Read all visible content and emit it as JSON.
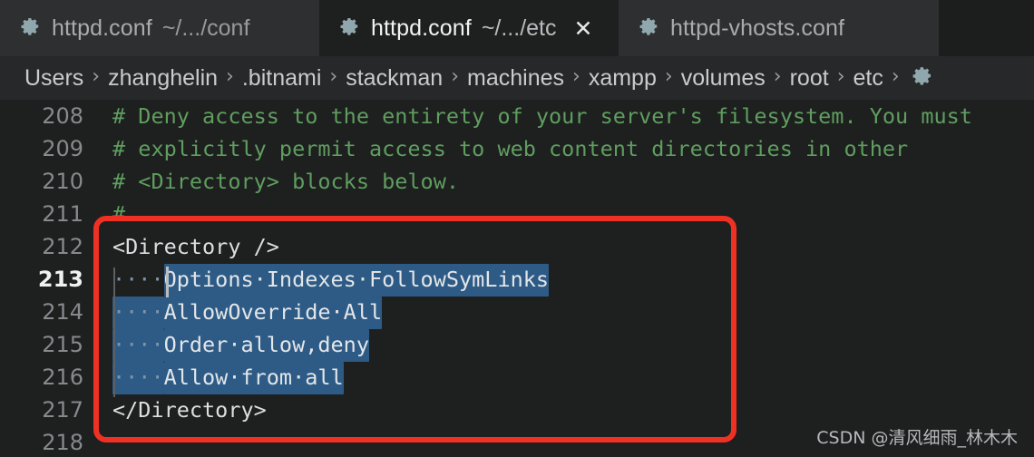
{
  "colors": {
    "tabbar_bg": "#1c1d1d",
    "tab_inactive_bg": "#2d2f30",
    "tab_active_bg": "#1e1f1f",
    "breadcrumb_bg": "#262829",
    "editor_bg": "#1e1f1f",
    "selection": "#2d5b86",
    "comment_green": "#5f9e5f",
    "annotation_red": "#ef3124",
    "gear_icon": "#90a7ad",
    "line_number": "#868a8c",
    "code_text": "#d4d6d7"
  },
  "tabs": [
    {
      "icon": "gear-icon",
      "title": "httpd.conf",
      "path": "~/.../conf",
      "active": false,
      "closable": false
    },
    {
      "icon": "gear-icon",
      "title": "httpd.conf",
      "path": "~/.../etc",
      "active": true,
      "closable": true,
      "close_label": "✕"
    },
    {
      "icon": "gear-icon",
      "title": "httpd-vhosts.conf",
      "path": "",
      "active": false,
      "closable": false
    }
  ],
  "breadcrumb": {
    "separator": "›",
    "items": [
      "Users",
      "zhanghelin",
      ".bitnami",
      "stackman",
      "machines",
      "xampp",
      "volumes",
      "root",
      "etc"
    ],
    "trailing_icon": "gear-icon"
  },
  "editor": {
    "active_line": 213,
    "lines": [
      {
        "number": "208",
        "kind": "comment",
        "text": "# Deny access to the entirety of your server's filesystem. You must"
      },
      {
        "number": "209",
        "kind": "comment",
        "text": "# explicitly permit access to web content directories in other"
      },
      {
        "number": "210",
        "kind": "comment",
        "text": "# <Directory> blocks below."
      },
      {
        "number": "211",
        "kind": "comment",
        "text": "#"
      },
      {
        "number": "212",
        "kind": "plain",
        "text": "<Directory />"
      },
      {
        "number": "213",
        "kind": "selected",
        "indent_ws": "····",
        "text": "Options·Indexes·FollowSymLinks",
        "indent_selected": false
      },
      {
        "number": "214",
        "kind": "selected",
        "indent_ws": "····",
        "text": "AllowOverride·All",
        "indent_selected": true
      },
      {
        "number": "215",
        "kind": "selected",
        "indent_ws": "····",
        "text": "Order·allow,deny",
        "indent_selected": true
      },
      {
        "number": "216",
        "kind": "selected",
        "indent_ws": "····",
        "text": "Allow·from·all",
        "indent_selected": true
      },
      {
        "number": "217",
        "kind": "plain",
        "text": "</Directory>"
      },
      {
        "number": "218",
        "kind": "plain",
        "text": ""
      }
    ]
  },
  "annotation": {
    "shape": "red-rounded-rectangle",
    "covers_lines": "211-218"
  },
  "watermark": {
    "text": "CSDN @清风细雨_林木木"
  }
}
